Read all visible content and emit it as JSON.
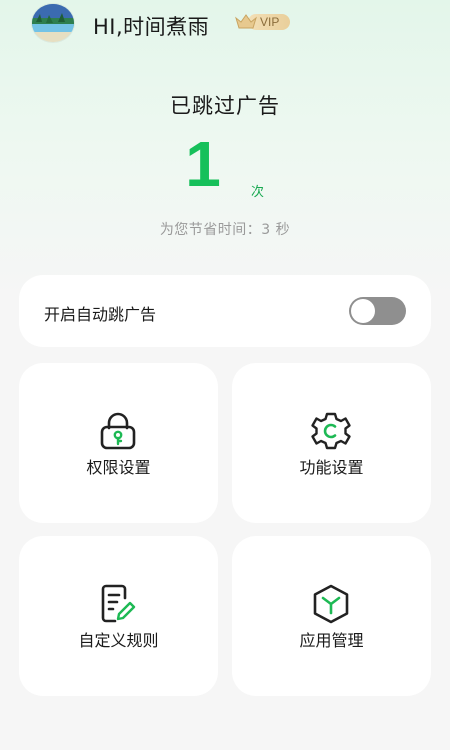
{
  "header": {
    "avatar_icon": "landscape-avatar",
    "username": "HI,时间煮雨",
    "badge": "VIP"
  },
  "stats": {
    "title": "已跳过广告",
    "count": "1",
    "count_unit": "次",
    "saved_time": "为您节省时间：3 秒"
  },
  "auto_skip": {
    "label": "开启自动跳广告",
    "enabled": false
  },
  "tiles": [
    {
      "label": "权限设置",
      "icon": "lock-key-icon"
    },
    {
      "label": "功能设置",
      "icon": "gear-icon"
    },
    {
      "label": "自定义规则",
      "icon": "document-edit-icon"
    },
    {
      "label": "应用管理",
      "icon": "cube-icon"
    }
  ],
  "colors": {
    "accent": "#16c05a",
    "icon_stroke": "#222222",
    "icon_accent": "#1db954",
    "toggle_off": "#8f8f8f"
  }
}
